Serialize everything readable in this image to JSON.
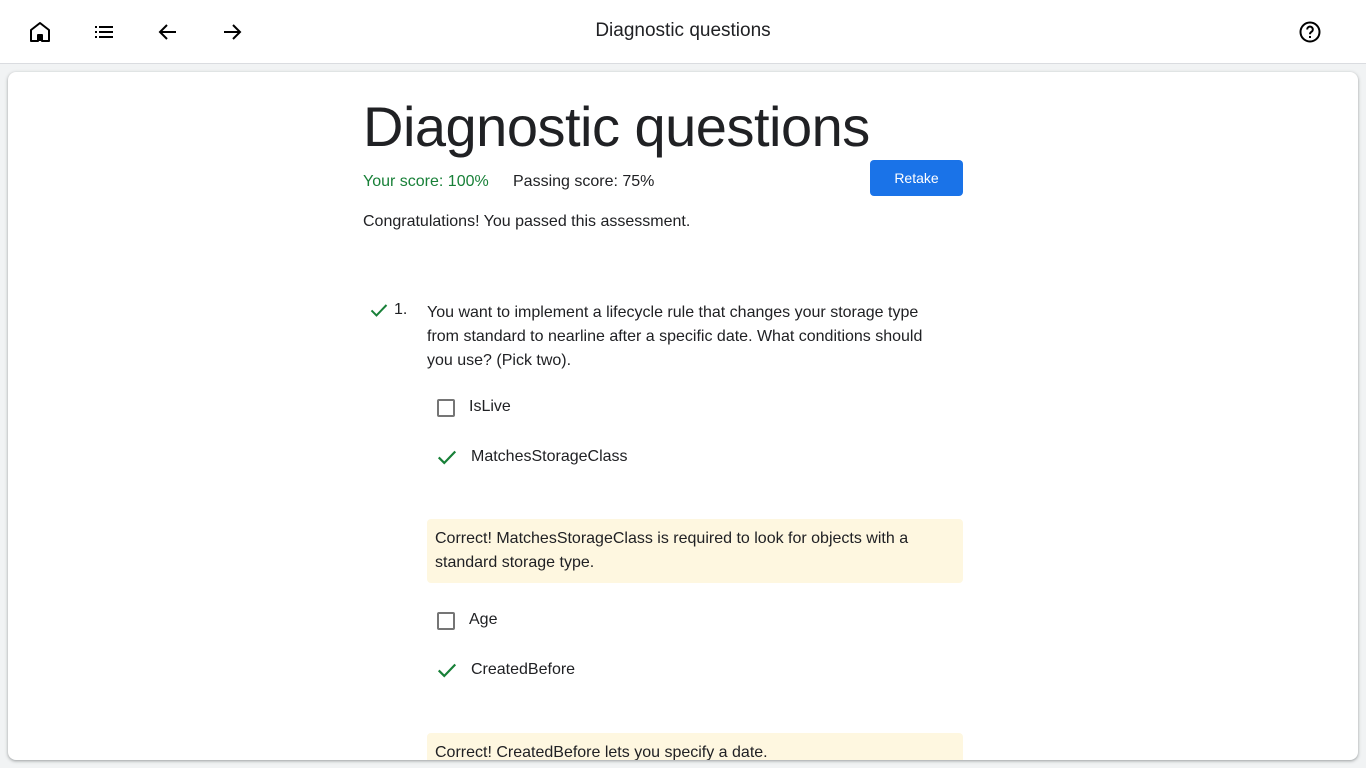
{
  "topbar": {
    "title": "Diagnostic questions",
    "icons": [
      "home-icon",
      "list-icon",
      "arrow-back-icon",
      "arrow-forward-icon",
      "help-icon"
    ]
  },
  "page": {
    "title": "Diagnostic questions",
    "score_text": "Your score: 100%",
    "passing_text": "Passing score: 75%",
    "retake_label": "Retake",
    "congrats_text": "Congratulations! You passed this assessment."
  },
  "colors": {
    "accent": "#1a73e8",
    "success": "#188038",
    "feedback_bg": "#fef7e0"
  },
  "question": {
    "number": "1.",
    "text": "You want to implement a lifecycle rule that changes your storage type from standard to nearline after a specific date. What conditions should you use? (Pick two).",
    "options": [
      {
        "label": "IsLive",
        "selected": false
      },
      {
        "label": "MatchesStorageClass",
        "selected": true,
        "feedback": "Correct! MatchesStorageClass is required to look for objects with a standard storage type."
      },
      {
        "label": "Age",
        "selected": false
      },
      {
        "label": "CreatedBefore",
        "selected": true,
        "feedback": "Correct! CreatedBefore lets you specify a date."
      }
    ]
  }
}
